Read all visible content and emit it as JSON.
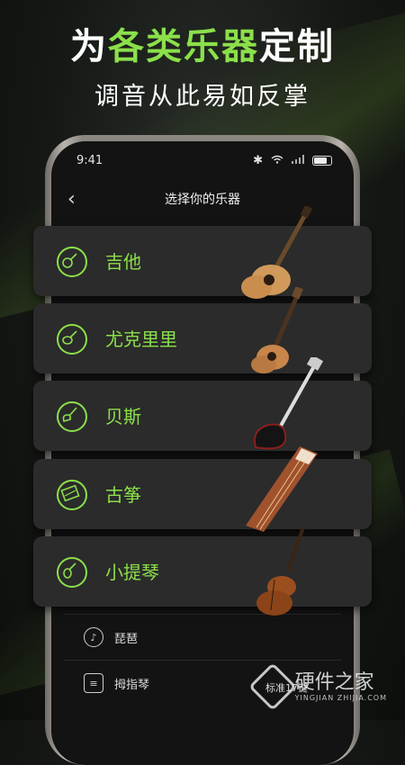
{
  "promo": {
    "headline_pre": "为",
    "headline_highlight": "各类乐器",
    "headline_post": "定制",
    "subline": "调音从此易如反掌"
  },
  "status_bar": {
    "time": "9:41"
  },
  "nav": {
    "title": "选择你的乐器"
  },
  "instrument_cards": [
    {
      "label": "吉他",
      "icon": "guitar-icon"
    },
    {
      "label": "尤克里里",
      "icon": "ukulele-icon"
    },
    {
      "label": "贝斯",
      "icon": "bass-icon"
    },
    {
      "label": "古筝",
      "icon": "guzheng-icon"
    },
    {
      "label": "小提琴",
      "icon": "violin-icon"
    }
  ],
  "more_instruments": [
    {
      "label": "琵琶",
      "icon": "pipa-icon"
    },
    {
      "label": "拇指琴",
      "icon": "kalimba-icon"
    }
  ],
  "bottom_tag": "标准17键",
  "watermark": {
    "text": "硬件之家",
    "sub": "YINGJIAN ZHIJIA.COM"
  },
  "colors": {
    "accent": "#8be04a",
    "card_bg": "#2b2b2b",
    "background": "#131313"
  }
}
